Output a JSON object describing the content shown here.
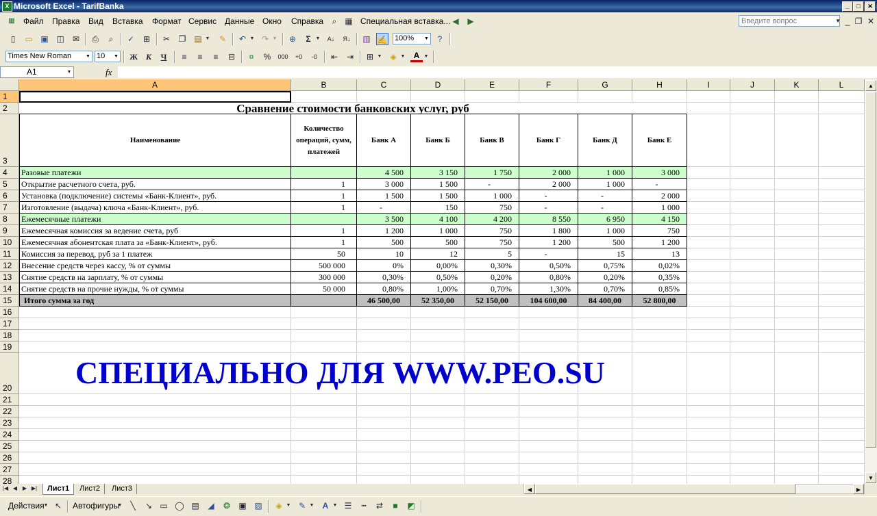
{
  "window": {
    "title": "Microsoft Excel - TarifBanka"
  },
  "menu": [
    "Файл",
    "Правка",
    "Вид",
    "Вставка",
    "Формат",
    "Сервис",
    "Данные",
    "Окно",
    "Справка"
  ],
  "menu_extra": {
    "paste_special": "Специальная вставка..."
  },
  "ask": {
    "placeholder": "Введите вопрос"
  },
  "toolbar": {
    "zoom": "100%",
    "font": "Times New Roman",
    "size": "10",
    "bold": "Ж",
    "italic": "К",
    "underline": "Ч",
    "percent": "%",
    "thousands": "000",
    "sum": "Σ"
  },
  "namebox": {
    "value": "A1"
  },
  "formula": {
    "fx": "fx",
    "value": ""
  },
  "columns": [
    "A",
    "B",
    "C",
    "D",
    "E",
    "F",
    "G",
    "H",
    "I",
    "J",
    "K",
    "L"
  ],
  "rows": [
    "1",
    "2",
    "3",
    "4",
    "5",
    "6",
    "7",
    "8",
    "9",
    "10",
    "11",
    "12",
    "13",
    "14",
    "15",
    "16",
    "17",
    "18",
    "19",
    "20",
    "21",
    "22",
    "23",
    "24",
    "25",
    "26",
    "27",
    "28"
  ],
  "sheet": {
    "title": "Сравнение стоимости банковских услуг, руб",
    "headers": [
      "Наименование",
      "Количество операций, сумм, платежей",
      "Банк А",
      "Банк Б",
      "Банк В",
      "Банк Г",
      "Банк Д",
      "Банк Е"
    ],
    "table": [
      {
        "name": "Разовые платежи",
        "qty": "",
        "vals": [
          "4 500",
          "3 150",
          "1 750",
          "2 000",
          "1 000",
          "3 000"
        ]
      },
      {
        "name": "Открытие расчетного счета, руб.",
        "qty": "1",
        "vals": [
          "3 000",
          "1 500",
          "-",
          "2 000",
          "1 000",
          "-"
        ]
      },
      {
        "name": "Установка (подключение) системы «Банк-Клиент», руб.",
        "qty": "1",
        "vals": [
          "1 500",
          "1 500",
          "1 000",
          "-",
          "-",
          "2 000"
        ]
      },
      {
        "name": "Изготовление (выдача) ключа «Банк-Клиент», руб.",
        "qty": "1",
        "vals": [
          "-",
          "150",
          "750",
          "-",
          "-",
          "1 000"
        ]
      },
      {
        "name": "Ежемесячные платежи",
        "qty": "",
        "vals": [
          "3 500",
          "4 100",
          "4 200",
          "8 550",
          "6 950",
          "4 150"
        ]
      },
      {
        "name": "Ежемесячная комиссия за ведение счета, руб",
        "qty": "1",
        "vals": [
          "1 200",
          "1 000",
          "750",
          "1 800",
          "1 000",
          "750"
        ]
      },
      {
        "name": "Ежемесячная абонентская плата за «Банк-Клиент», руб.",
        "qty": "1",
        "vals": [
          "500",
          "500",
          "750",
          "1 200",
          "500",
          "1 200"
        ]
      },
      {
        "name": "Комиссия за перевод, руб за 1 платеж",
        "qty": "50",
        "vals": [
          "10",
          "12",
          "5",
          "-",
          "15",
          "13"
        ]
      },
      {
        "name": "Внесение средств через кассу, % от суммы",
        "qty": "500 000",
        "vals": [
          "0%",
          "0,00%",
          "0,30%",
          "0,50%",
          "0,75%",
          "0,02%"
        ]
      },
      {
        "name": "Снятие средств на зарплату, % от суммы",
        "qty": "300 000",
        "vals": [
          "0,30%",
          "0,50%",
          "0,20%",
          "0,80%",
          "0,20%",
          "0,35%"
        ]
      },
      {
        "name": "Снятие средств на прочие нужды, % от суммы",
        "qty": "50 000",
        "vals": [
          "0,80%",
          "1,00%",
          "0,70%",
          "1,30%",
          "0,70%",
          "0,85%"
        ]
      },
      {
        "name": "Итого сумма за год",
        "qty": "",
        "vals": [
          "46 500,00",
          "52 350,00",
          "52 150,00",
          "104 600,00",
          "84 400,00",
          "52 800,00"
        ]
      }
    ],
    "watermark": "СПЕЦИАЛЬНО ДЛЯ WWW.PEO.SU"
  },
  "tabs": [
    "Лист1",
    "Лист2",
    "Лист3"
  ],
  "drawing": {
    "actions": "Действия",
    "autoshapes": "Автофигуры"
  }
}
